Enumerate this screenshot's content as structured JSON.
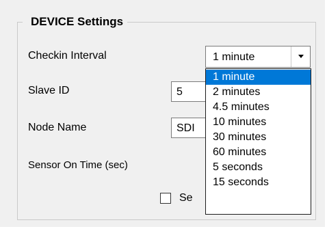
{
  "group": {
    "title": "DEVICE Settings"
  },
  "checkin": {
    "label": "Checkin Interval",
    "value": "1 minute",
    "arrow_icon": "chevron-down-icon",
    "options": [
      "1 minute",
      "2 minutes",
      "4.5 minutes",
      "10 minutes",
      "30 minutes",
      "60 minutes",
      "5 seconds",
      "15 seconds"
    ],
    "highlighted": "1 minute"
  },
  "slave_id": {
    "label": "Slave ID",
    "value": "5"
  },
  "node_name": {
    "label": "Node Name",
    "value": "SDI"
  },
  "sensor_on_time": {
    "label": "Sensor On Time (sec)"
  },
  "checkbox": {
    "label": "Se",
    "checked": false
  },
  "colors": {
    "highlight": "#0078d7",
    "panel": "#f0f0f0",
    "border": "#7a7a7a"
  }
}
